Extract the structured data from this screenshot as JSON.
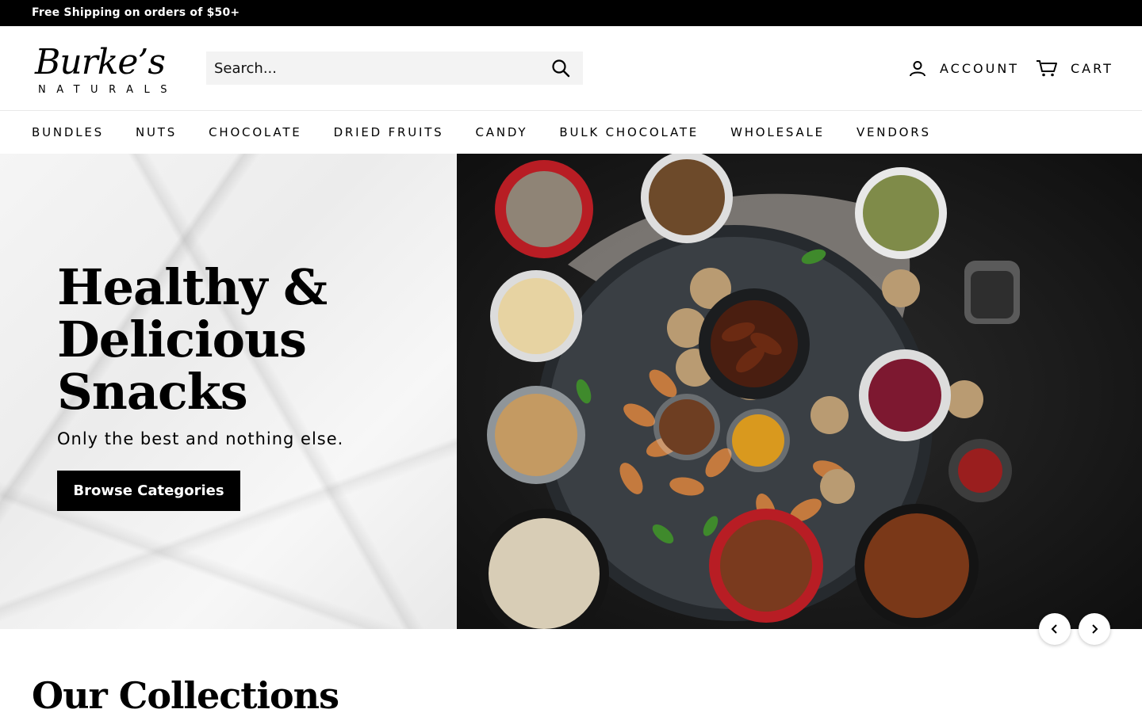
{
  "announcement": {
    "text": "Free Shipping on orders of $50+"
  },
  "logo": {
    "script": "Burke’s",
    "sub": "NATURALS"
  },
  "search": {
    "placeholder": "Search..."
  },
  "header": {
    "account_label": "ACCOUNT",
    "cart_label": "CART"
  },
  "nav": {
    "items": [
      {
        "label": "BUNDLES"
      },
      {
        "label": "NUTS"
      },
      {
        "label": "CHOCOLATE"
      },
      {
        "label": "DRIED FRUITS"
      },
      {
        "label": "CANDY"
      },
      {
        "label": "BULK CHOCOLATE"
      },
      {
        "label": "WHOLESALE"
      },
      {
        "label": "VENDORS"
      }
    ]
  },
  "hero": {
    "title": "Healthy & Delicious Snacks",
    "subtitle": "Only the best and nothing else.",
    "cta_label": "Browse Categories"
  },
  "collections": {
    "title": "Our Collections"
  },
  "colors": {
    "announcement_bg": "#000000",
    "button_bg": "#000000",
    "search_bg": "#f3f3f3"
  }
}
